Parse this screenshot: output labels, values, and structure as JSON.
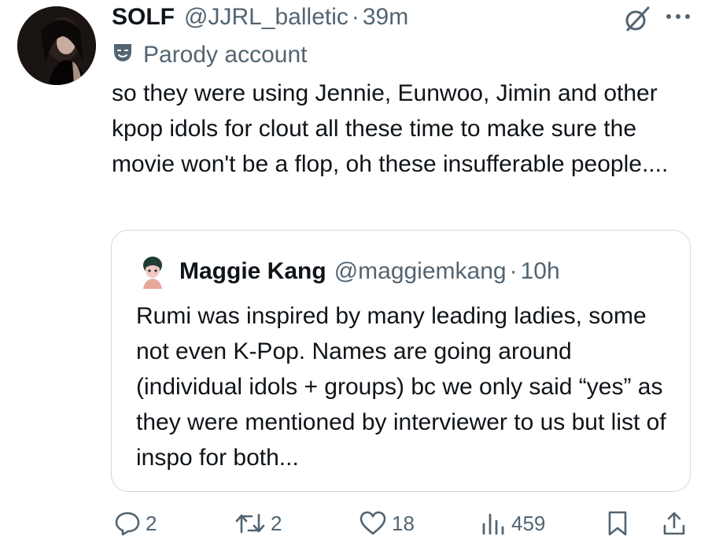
{
  "tweet": {
    "display_name": "SOLF",
    "handle": "@JJRL_balletic",
    "separator": "·",
    "time": "39m",
    "parody_label": "Parody account",
    "text": "so they were using Jennie, Eunwoo, Jimin and other kpop idols for clout all these time to make sure the movie won't be a flop, oh these insufferable people...."
  },
  "quote": {
    "display_name": "Maggie Kang",
    "handle": "@maggiemkang",
    "separator": "·",
    "time": "10h",
    "text": "Rumi was inspired by many leading ladies, some not even K-Pop. Names are going around (individual idols + groups) bc we only said “yes” as they were mentioned by interviewer to us but list of inspo for both..."
  },
  "actions": {
    "replies": "2",
    "reposts": "2",
    "likes": "18",
    "views": "459"
  },
  "icons": {
    "grok": "grok-icon",
    "more": "more-dots-icon",
    "parody": "mask-icon",
    "reply": "speech-bubble-icon",
    "repost": "repost-icon",
    "like": "heart-icon",
    "views": "bar-chart-icon",
    "bookmark": "bookmark-icon",
    "share": "share-icon"
  },
  "colors": {
    "text": "#0f1419",
    "secondary": "#536471",
    "border": "#cfd9de"
  }
}
